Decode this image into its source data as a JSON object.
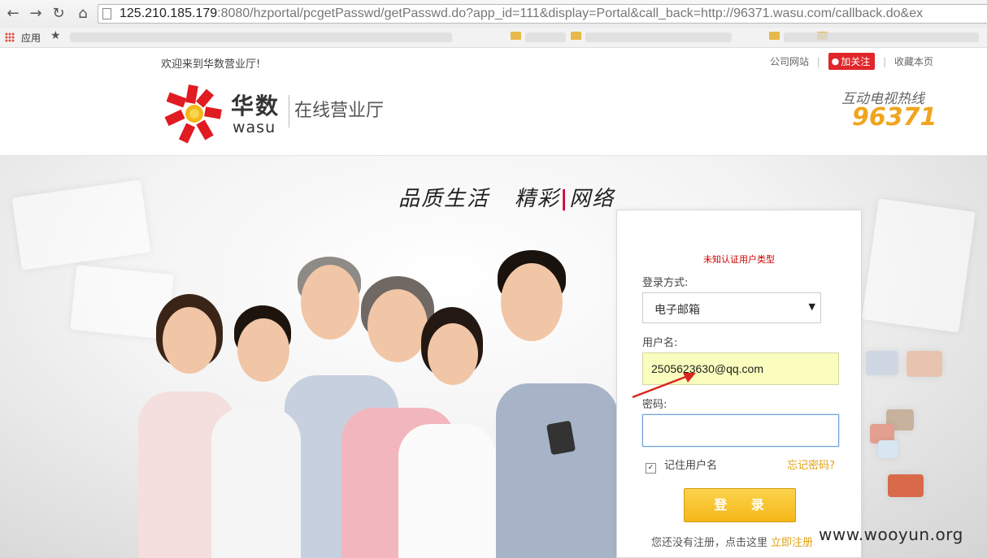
{
  "browser": {
    "url_host": "125.210.185.179",
    "url_rest": ":8080/hzportal/pcgetPasswd/getPasswd.do?app_id=111&display=Portal&call_back=http://96371.wasu.com/callback.do&ex",
    "bookmarks_label": "应用"
  },
  "topbar": {
    "welcome": "欢迎来到华数营业厅!",
    "company_site": "公司网站",
    "follow": "加关注",
    "bookmark_page": "收藏本页"
  },
  "brand": {
    "name_cn": "华数",
    "name_en": "wasu",
    "subtitle": "在线营业厅",
    "hotline_label": "互动电视热线",
    "hotline_number": "96371"
  },
  "banner": {
    "slogan_a": "品质生活",
    "slogan_b": "精彩",
    "slogan_c": "网络"
  },
  "login": {
    "error": "未知认证用户类型",
    "method_label": "登录方式:",
    "method_value": "电子邮箱",
    "username_label": "用户名:",
    "username_value": "2505623630@qq.com",
    "password_label": "密码:",
    "password_value": "",
    "remember_label": "记住用户名",
    "remember_checked": true,
    "forgot": "忘记密码?",
    "submit": "登 录",
    "register_note": "您还没有注册，点击这里",
    "register_link": "立即注册"
  },
  "watermark": "www.wooyun.org",
  "colors": {
    "accent": "#f5b719",
    "error": "#cc0000",
    "link": "#e0a213",
    "hotline": "#f0a51e"
  }
}
